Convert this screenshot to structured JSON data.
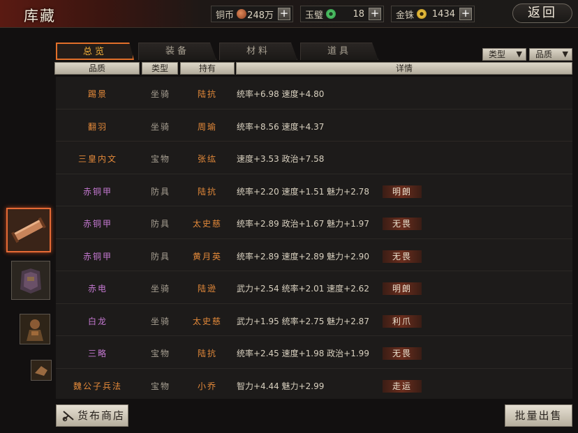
{
  "title": "库藏",
  "resources": [
    {
      "label": "铜币",
      "value": "248万",
      "coin_color": "#b8643c",
      "coin_icon": "copper-coin-icon"
    },
    {
      "label": "玉璧",
      "value": "18",
      "coin_color": "#3fae55",
      "coin_icon": "jade-icon"
    },
    {
      "label": "金铢",
      "value": "1434",
      "coin_color": "#d6a92a",
      "coin_icon": "gold-coin-icon"
    }
  ],
  "plus_label": "+",
  "back_label": "返回",
  "tabs": [
    "总览",
    "装备",
    "材料",
    "道具"
  ],
  "filters": {
    "type": "类型",
    "quality": "品质",
    "arrow": "▼"
  },
  "headers": {
    "quality": "品质",
    "type": "类型",
    "owner": "持有",
    "detail": "详情"
  },
  "rows": [
    {
      "name": "踢景",
      "type": "坐骑",
      "owner": "陆抗",
      "stats": "统率+6.98  速度+4.80",
      "tag": "",
      "color": "orange"
    },
    {
      "name": "翻羽",
      "type": "坐骑",
      "owner": "周瑜",
      "stats": "统率+8.56  速度+4.37",
      "tag": "",
      "color": "orange"
    },
    {
      "name": "三皇内文",
      "type": "宝物",
      "owner": "张纮",
      "stats": "速度+3.53  政治+7.58",
      "tag": "",
      "color": "orange"
    },
    {
      "name": "赤铜甲",
      "type": "防具",
      "owner": "陆抗",
      "stats": "统率+2.20  速度+1.51  魅力+2.78",
      "tag": "明朗",
      "color": "purple"
    },
    {
      "name": "赤铜甲",
      "type": "防具",
      "owner": "太史慈",
      "stats": "统率+2.89  政治+1.67  魅力+1.97",
      "tag": "无畏",
      "color": "purple"
    },
    {
      "name": "赤铜甲",
      "type": "防具",
      "owner": "黄月英",
      "stats": "统率+2.89  速度+2.89  魅力+2.90",
      "tag": "无畏",
      "color": "purple"
    },
    {
      "name": "赤电",
      "type": "坐骑",
      "owner": "陆逊",
      "stats": "武力+2.54  统率+2.01  速度+2.62",
      "tag": "明朗",
      "color": "purple"
    },
    {
      "name": "白龙",
      "type": "坐骑",
      "owner": "太史慈",
      "stats": "武力+1.95  统率+2.75  魅力+2.87",
      "tag": "利爪",
      "color": "purple"
    },
    {
      "name": "三略",
      "type": "宝物",
      "owner": "陆抗",
      "stats": "统率+2.45  速度+1.98  政治+1.99",
      "tag": "无畏",
      "color": "purple"
    },
    {
      "name": "魏公子兵法",
      "type": "宝物",
      "owner": "小乔",
      "stats": "智力+4.44  魅力+2.99",
      "tag": "走运",
      "color": "orange"
    }
  ],
  "thumbnails": [
    "scroll-item-icon",
    "armor-item-icon",
    "warrior-item-icon",
    "small-item-icon"
  ],
  "shop_button": "货布商店",
  "sell_button": "批量出售"
}
